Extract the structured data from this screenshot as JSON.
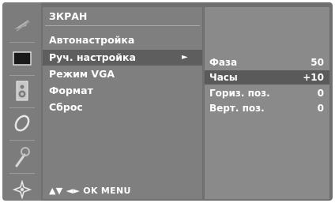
{
  "menu": {
    "title": "ЗКРАН",
    "items": [
      {
        "label": "Автонастройка"
      },
      {
        "label": "Руч. настройка",
        "arrow": "►"
      },
      {
        "label": "Режим VGA"
      },
      {
        "label": "Формат"
      },
      {
        "label": "Сброс"
      }
    ],
    "selected_index": 1
  },
  "nav_hint": "▲▼ ◄► OK MENU",
  "submenu": {
    "rows": [
      {
        "label": "Фаза",
        "value": "50"
      },
      {
        "label": "Часы",
        "value": "+10"
      },
      {
        "label": "Гориз. поз.",
        "value": "0"
      },
      {
        "label": "Верт. поз.",
        "value": "0"
      }
    ],
    "selected_index": 1
  },
  "sidebar_icons": [
    "picture-icon",
    "screen-icon",
    "audio-icon",
    "time-icon",
    "option-icon",
    "setup-icon"
  ],
  "colors": {
    "panel": "#6f6f6f",
    "selection": "#5e5e5e",
    "submenu": "#8a8a8a"
  }
}
